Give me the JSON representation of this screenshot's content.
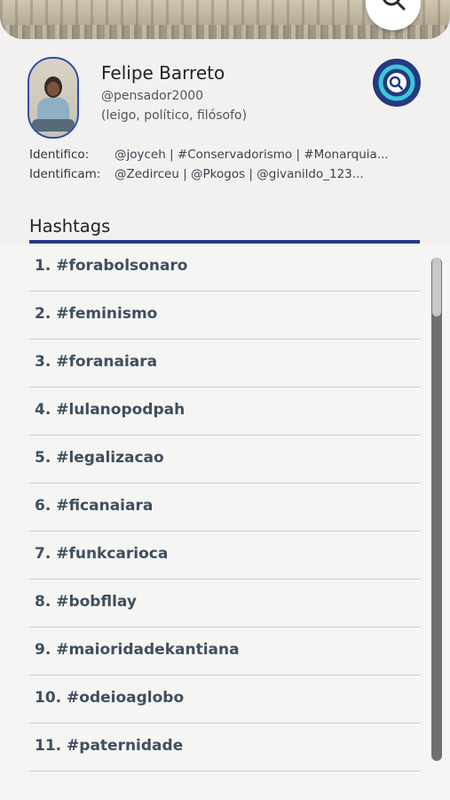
{
  "profile": {
    "name": "Felipe Barreto",
    "handle": "@pensador2000",
    "description": "(leigo, político, filósofo)",
    "identifico_label": "Identifico:",
    "identifico_value": "@joyceh | #Conservadorismo | #Monarquia...",
    "identificam_label": "Identificam:",
    "identificam_value": "@Zedirceu | @Pkogos | @givanildo_123...",
    "avatar_icon": "user-photo-icon"
  },
  "header": {
    "search_icon": "search-icon",
    "logo_icon": "app-logo-icon"
  },
  "hashtags": {
    "title": "Hashtags",
    "items": [
      "1. #forabolsonaro",
      "2. #feminismo",
      "3. #foranaiara",
      "4. #lulanopodpah",
      "5. #legalizacao",
      "6. #ficanaiara",
      "7. #funkcarioca",
      "8. #bobfllay",
      "9. #maioridadekantiana",
      "10. #odeioaglobo",
      "11. #paternidade"
    ]
  },
  "colors": {
    "accent": "#263a86",
    "logo_ring": "#3ec6d6",
    "background": "#f2f1ef"
  }
}
